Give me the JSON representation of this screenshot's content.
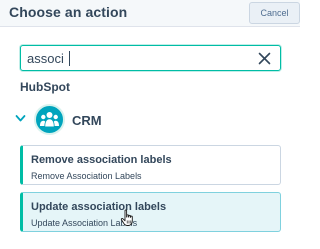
{
  "header": {
    "title": "Choose an action",
    "cancel_label": "Cancel"
  },
  "search": {
    "value": "associ",
    "placeholder": ""
  },
  "section": {
    "title": "HubSpot"
  },
  "group": {
    "label": "CRM",
    "icon": "crm-people-icon",
    "expanded": true
  },
  "actions": [
    {
      "title": "Remove association labels",
      "subtitle": "Remove Association Labels",
      "hovered": false
    },
    {
      "title": "Update association labels",
      "subtitle": "Update Association Labels",
      "hovered": true
    }
  ],
  "colors": {
    "accent": "#00bda5",
    "brand_teal": "#00a4bd",
    "text": "#33475b",
    "hover_bg": "#e5f5f8"
  }
}
